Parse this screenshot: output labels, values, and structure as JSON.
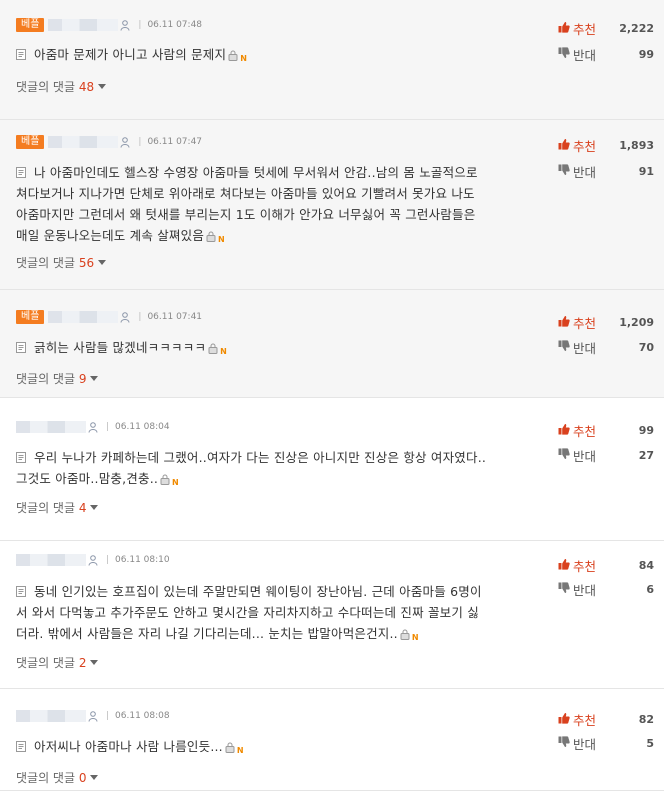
{
  "labels": {
    "replies_label": "댓글의 댓글",
    "up_label": "추천",
    "down_label": "반대",
    "best_badge": "베플",
    "sep": "|"
  },
  "colors": {
    "accent": "#d9411e",
    "badge": "#f47c20",
    "best_bg": "#f6f6f6"
  },
  "comments": [
    {
      "best": true,
      "time": "06.11 07:48",
      "lines": [
        "아줌마 문제가 아니고 사람의 문제지"
      ],
      "replies": "48",
      "up": "2,222",
      "down": "99"
    },
    {
      "best": true,
      "time": "06.11 07:47",
      "lines": [
        "나 아줌마인데도 헬스장 수영장 아줌마들 텃세에 무서워서 안감..남의 몸 노골적으로",
        "쳐다보거나 지나가면 단체로 위아래로 쳐다보는 아줌마들 있어요 기빨려서 못가요 나도",
        "아줌마지만 그런데서 왜 텃새를 부리는지 1도 이해가 안가요 너무싫어 꼭 그런사람들은",
        "매일 운동나오는데도 계속 살쪄있음"
      ],
      "replies": "56",
      "up": "1,893",
      "down": "91"
    },
    {
      "best": true,
      "time": "06.11 07:41",
      "lines": [
        "긁히는 사람들 많겠네ㅋㅋㅋㅋㅋ"
      ],
      "replies": "9",
      "up": "1,209",
      "down": "70"
    },
    {
      "best": false,
      "time": "06.11 08:04",
      "lines": [
        "우리 누나가 카페하는데 그랬어..여자가 다는 진상은 아니지만 진상은 항상 여자였다..",
        "그것도 아줌마..맘충,견충.."
      ],
      "replies": "4",
      "up": "99",
      "down": "27"
    },
    {
      "best": false,
      "time": "06.11 08:10",
      "lines": [
        "동네 인기있는 호프집이 있는데 주말만되면 웨이팅이 장난아님. 근데 아줌마들 6명이",
        "서 와서 다먹놓고 추가주문도 안하고 몇시간을 자리차지하고 수다떠는데 진짜 꼴보기 싫",
        "더라. 밖에서 사람들은 자리 나길 기다리는데... 눈치는 밥말아먹은건지.."
      ],
      "replies": "2",
      "up": "84",
      "down": "6"
    },
    {
      "best": false,
      "time": "06.11 08:08",
      "lines": [
        "아저씨나 아줌마나 사람 나름인듯..."
      ],
      "replies": "0",
      "up": "82",
      "down": "5"
    }
  ]
}
